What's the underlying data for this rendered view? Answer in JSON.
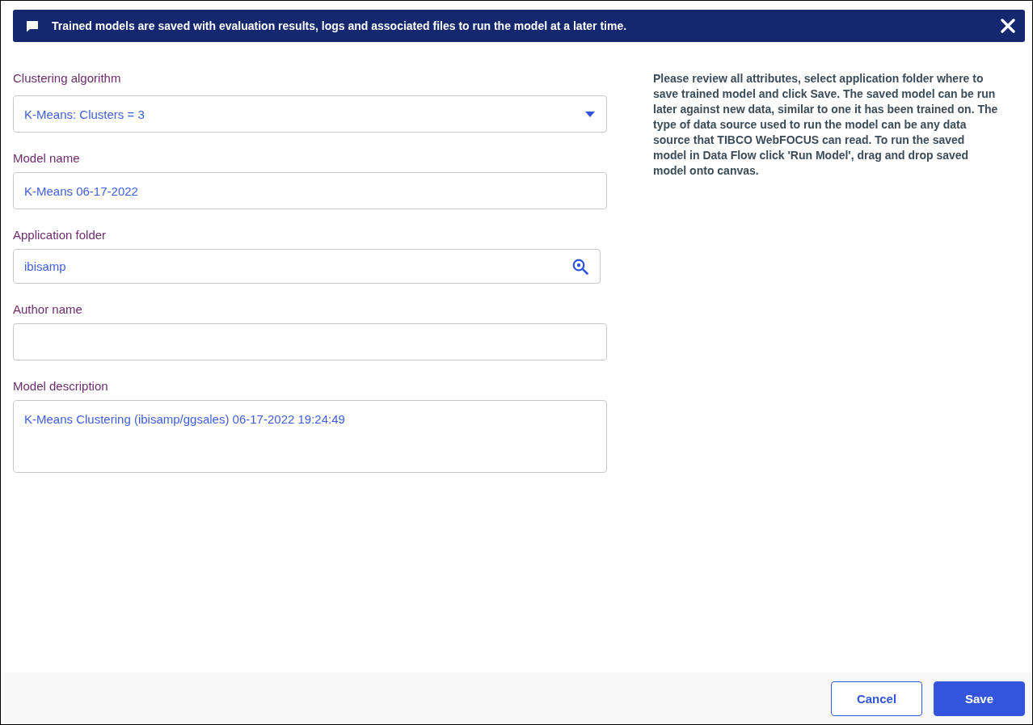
{
  "banner": {
    "text": "Trained models are saved with evaluation results, logs and associated files to run the model at a later time."
  },
  "fields": [
    {
      "kind": "select",
      "label": "Clustering algorithm",
      "value": "K-Means: Clusters = 3"
    },
    {
      "kind": "text",
      "label": "Model name",
      "value": "K-Means 06-17-2022"
    },
    {
      "kind": "search",
      "label": "Application folder",
      "value": "ibisamp"
    },
    {
      "kind": "text",
      "label": "Author name"
    },
    {
      "kind": "textarea",
      "label": "Model description",
      "value": "K-Means Clustering (ibisamp/ggsales) 06-17-2022 19:24:49"
    }
  ],
  "help_text": "Please review all attributes, select application folder where to save trained model and click Save. The saved model can be run later against new data, similar to one it has been trained on. The type of data source used to run the model can be any data source that TIBCO WebFOCUS can read. To run the saved model in Data Flow click 'Run Model', drag and drop saved model onto canvas.",
  "buttons": [
    {
      "kind": "secondary",
      "label": "Cancel"
    },
    {
      "kind": "primary",
      "label": "Save"
    }
  ]
}
